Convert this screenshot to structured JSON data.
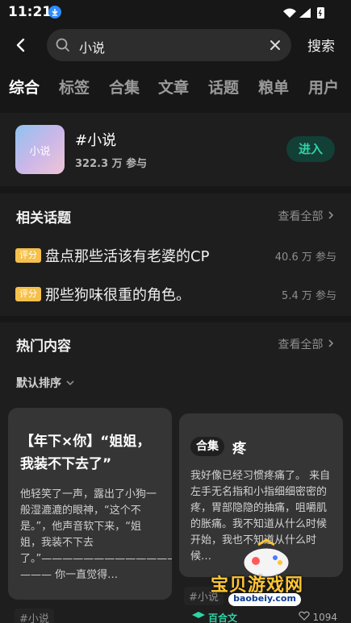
{
  "status": {
    "time": "11:21"
  },
  "search": {
    "query": "小说",
    "button": "搜索"
  },
  "tabs": [
    "综合",
    "标签",
    "合集",
    "文章",
    "话题",
    "粮单",
    "用户"
  ],
  "topic": {
    "thumb_text": "小说",
    "name": "#小说",
    "participants": "322.3 万 参与",
    "enter_label": "进入"
  },
  "related": {
    "title": "相关话题",
    "see_all": "查看全部",
    "items": [
      {
        "badge": "评分",
        "title": "盘点那些活该有老婆的CP",
        "count": "40.6 万 参与"
      },
      {
        "badge": "评分",
        "title": "那些狗味很重的角色。",
        "count": "5.4 万 参与"
      }
    ]
  },
  "hot": {
    "title": "热门内容",
    "see_all": "查看全部",
    "sort": "默认排序"
  },
  "cards": [
    {
      "title": "【年下×你】“姐姐，我装不下去了”",
      "body": "他轻笑了一声，露出了小狗一般湿漉漉的眼神，“这个不是。”，他声音软下来，“姐姐，我装不下去了。”———————————————— ——— 你一直觉得…",
      "hashtag": "#小说"
    },
    {
      "tag": "合集",
      "title": "疼",
      "body": "我好像已经习惯疼痛了。 来自左手无名指和小指细细密密的疼，胃部隐隐的抽痛，咀嚼肌的胀痛。我不知道从什么时候开始，我也不知道从什么时候…",
      "hashtag": "#小说",
      "footer_label": "百合文",
      "likes": "1094"
    }
  ],
  "watermark": {
    "text": "宝贝游戏网",
    "url": "baobeiy.com"
  },
  "colors": {
    "accent": "#2fd3a6",
    "badge": "#f5c04b",
    "bg": "#171717"
  }
}
